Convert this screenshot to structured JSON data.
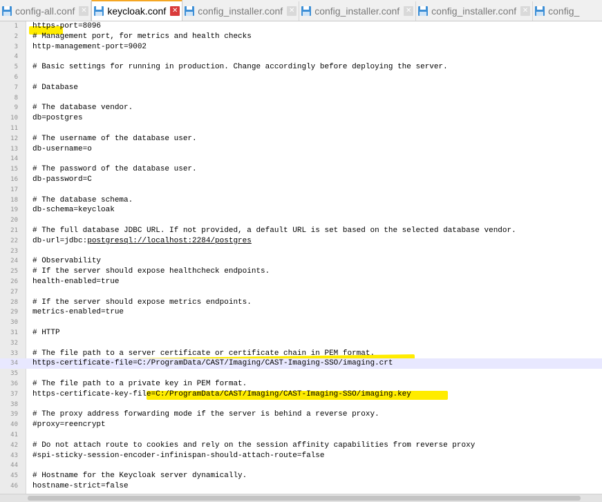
{
  "tabs": [
    {
      "name": "config-all.conf",
      "active": false
    },
    {
      "name": "keycloak.conf",
      "active": true
    },
    {
      "name": "config_installer.conf",
      "active": false
    },
    {
      "name": "config_installer.conf",
      "active": false
    },
    {
      "name": "config_installer.conf",
      "active": false
    },
    {
      "name": "config_",
      "active": false
    }
  ],
  "icons": {
    "file": "floppy-disk-icon",
    "close": "close-icon"
  },
  "colors": {
    "highlight": "#ffec00",
    "active_tab_accent": "#f5a623",
    "close_active": "#d93a3a",
    "current_line": "#e8e8ff"
  },
  "current_line": 34,
  "lines": [
    {
      "n": "1",
      "text": "https-port=8096"
    },
    {
      "n": "2",
      "text": "# Management port, for metrics and health checks"
    },
    {
      "n": "3",
      "text": "http-management-port=9002"
    },
    {
      "n": "4",
      "text": ""
    },
    {
      "n": "5",
      "text": "# Basic settings for running in production. Change accordingly before deploying the server."
    },
    {
      "n": "6",
      "text": ""
    },
    {
      "n": "7",
      "text": "# Database"
    },
    {
      "n": "8",
      "text": ""
    },
    {
      "n": "9",
      "text": "# The database vendor."
    },
    {
      "n": "10",
      "text": "db=postgres"
    },
    {
      "n": "11",
      "text": ""
    },
    {
      "n": "12",
      "text": "# The username of the database user."
    },
    {
      "n": "13",
      "text": "db-username=o"
    },
    {
      "n": "14",
      "text": ""
    },
    {
      "n": "15",
      "text": "# The password of the database user."
    },
    {
      "n": "16",
      "text": "db-password=C"
    },
    {
      "n": "17",
      "text": ""
    },
    {
      "n": "18",
      "text": "# The database schema."
    },
    {
      "n": "19",
      "text": "db-schema=keycloak"
    },
    {
      "n": "20",
      "text": ""
    },
    {
      "n": "21",
      "text": "# The full database JDBC URL. If not provided, a default URL is set based on the selected database vendor."
    },
    {
      "n": "22",
      "text": "db-url=jdbc:",
      "link": "postgresql://localhost:2284/postgres"
    },
    {
      "n": "23",
      "text": ""
    },
    {
      "n": "24",
      "text": "# Observability"
    },
    {
      "n": "25",
      "text": "# If the server should expose healthcheck endpoints."
    },
    {
      "n": "26",
      "text": "health-enabled=true"
    },
    {
      "n": "27",
      "text": ""
    },
    {
      "n": "28",
      "text": "# If the server should expose metrics endpoints."
    },
    {
      "n": "29",
      "text": "metrics-enabled=true"
    },
    {
      "n": "30",
      "text": ""
    },
    {
      "n": "31",
      "text": "# HTTP"
    },
    {
      "n": "32",
      "text": ""
    },
    {
      "n": "33",
      "text": "# The file path to a server certificate or certificate chain in PEM format."
    },
    {
      "n": "34",
      "text": "https-certificate-file=C:/ProgramData/CAST/Imaging/CAST-Imaging-SSO/imaging.crt"
    },
    {
      "n": "35",
      "text": ""
    },
    {
      "n": "36",
      "text": "# The file path to a private key in PEM format."
    },
    {
      "n": "37",
      "text": "https-certificate-key-file=C:/ProgramData/CAST/Imaging/CAST-Imaging-SSO/imaging.key"
    },
    {
      "n": "38",
      "text": ""
    },
    {
      "n": "39",
      "text": "# The proxy address forwarding mode if the server is behind a reverse proxy."
    },
    {
      "n": "40",
      "text": "#proxy=reencrypt"
    },
    {
      "n": "41",
      "text": ""
    },
    {
      "n": "42",
      "text": "# Do not attach route to cookies and rely on the session affinity capabilities from reverse proxy"
    },
    {
      "n": "43",
      "text": "#spi-sticky-session-encoder-infinispan-should-attach-route=false"
    },
    {
      "n": "44",
      "text": ""
    },
    {
      "n": "45",
      "text": "# Hostname for the Keycloak server dynamically."
    },
    {
      "n": "46",
      "text": "hostname-strict=false"
    }
  ]
}
